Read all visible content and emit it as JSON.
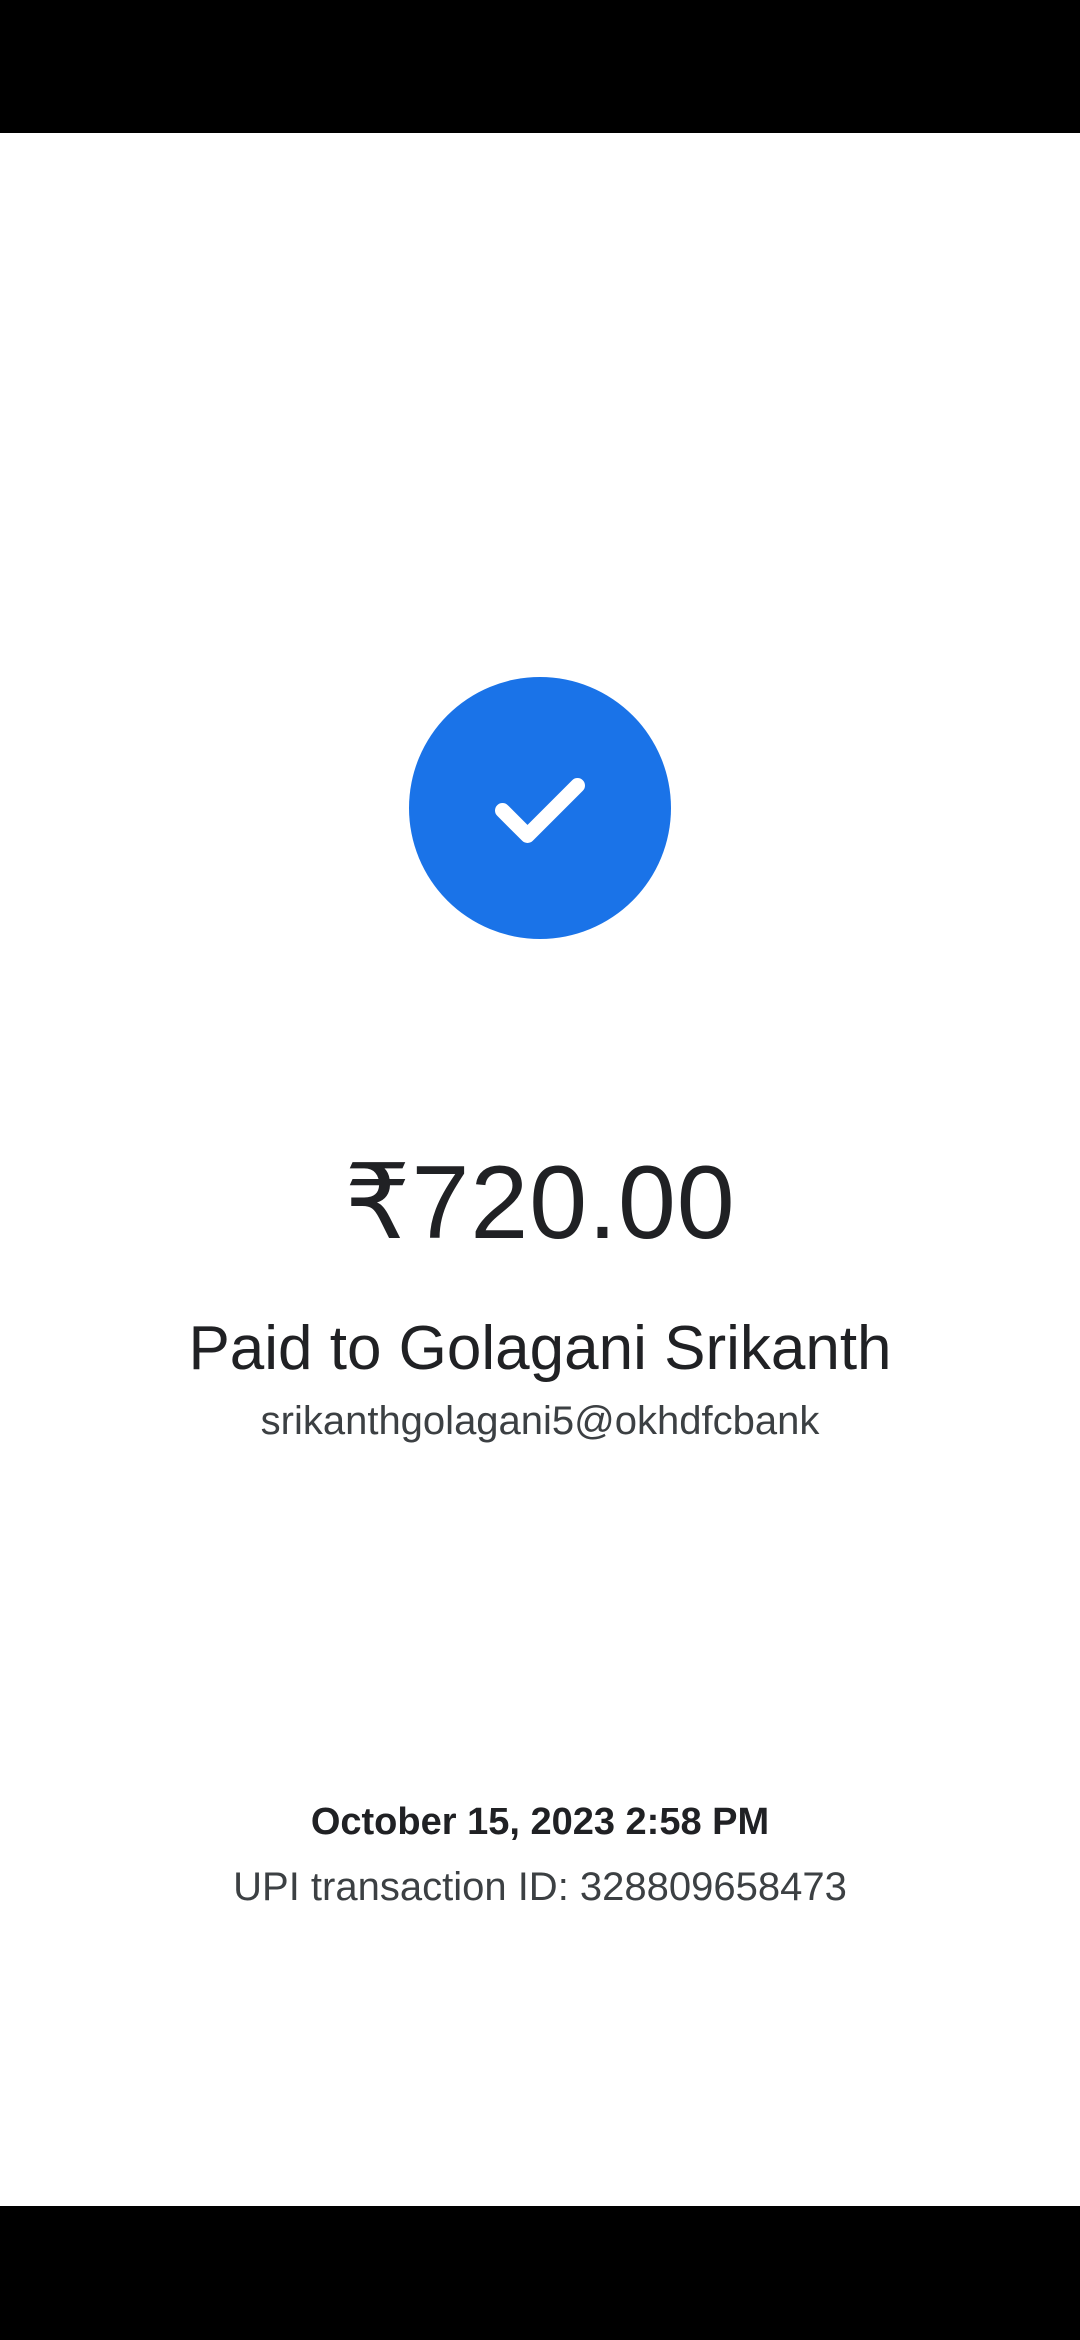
{
  "payment": {
    "status_icon": "check-icon",
    "amount": "₹720.00",
    "payee_line": "Paid to Golagani Srikanth",
    "payee_upi_id": "srikanthgolagani5@okhdfcbank"
  },
  "transaction": {
    "datetime": "October 15, 2023 2:58 PM",
    "upi_id_line": "UPI transaction ID: 328809658473"
  },
  "colors": {
    "success_blue": "#1a73e8",
    "background": "#ffffff",
    "system_bars": "#000000"
  }
}
